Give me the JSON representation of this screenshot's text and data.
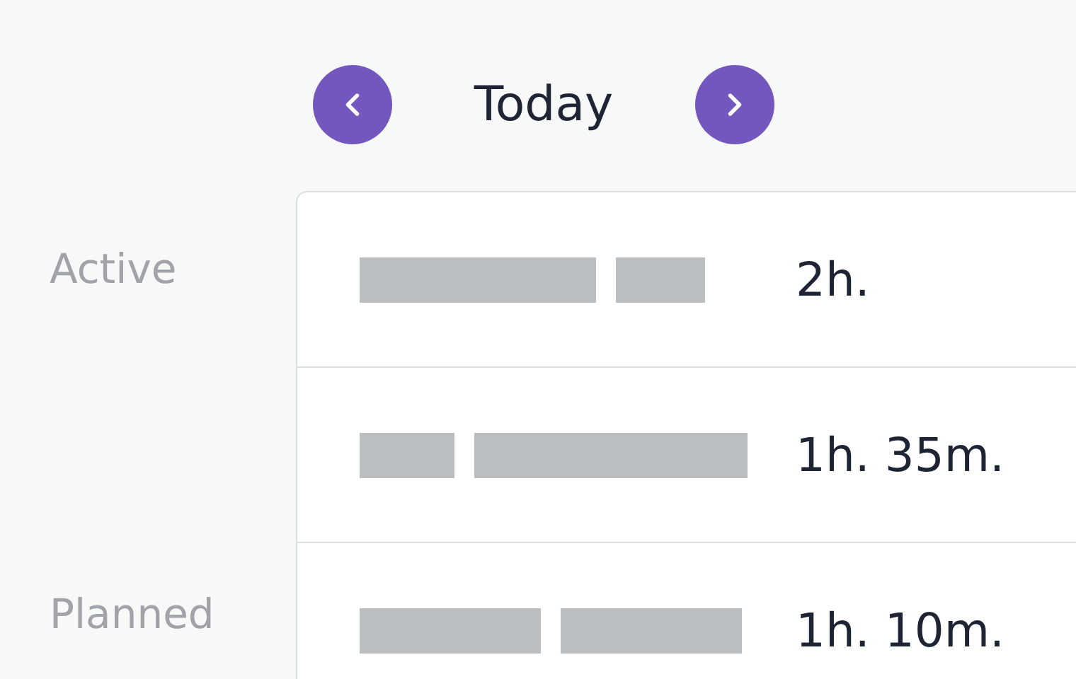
{
  "header": {
    "title": "Today"
  },
  "sections": [
    {
      "label": "Active",
      "entries": [
        {
          "duration": "2h."
        },
        {
          "duration": "1h. 35m."
        }
      ]
    },
    {
      "label": "Planned",
      "entries": [
        {
          "duration": "1h. 10m."
        }
      ]
    }
  ]
}
